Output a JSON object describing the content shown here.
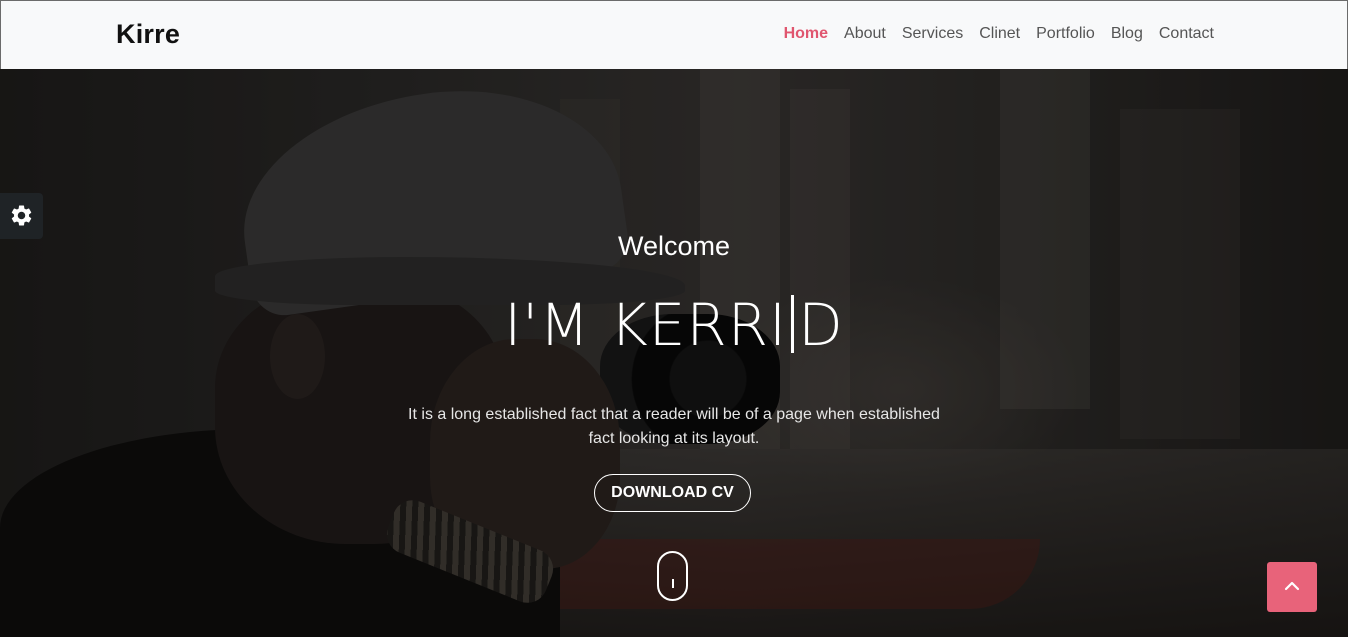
{
  "brand": {
    "name": "Kirre"
  },
  "nav": {
    "items": [
      {
        "label": "Home",
        "active": true
      },
      {
        "label": "About"
      },
      {
        "label": "Services"
      },
      {
        "label": "Clinet"
      },
      {
        "label": "Portfolio"
      },
      {
        "label": "Blog"
      },
      {
        "label": "Contact"
      }
    ]
  },
  "hero": {
    "welcome": "Welcome",
    "headline_part1": "I'M KERRI",
    "headline_part2": "D",
    "tagline": "It is a long established fact that a reader will be of a page when established fact looking at its layout.",
    "cv_button": "DOWNLOAD CV"
  },
  "icons": {
    "settings": "gear-icon",
    "back_to_top": "chevron-up-icon",
    "scroll": "mouse-scroll-icon"
  },
  "colors": {
    "accent": "#e0566f",
    "back_to_top_bg": "#e8637a",
    "navbar_bg": "#f8f9fa",
    "settings_bg": "#1f2326"
  }
}
